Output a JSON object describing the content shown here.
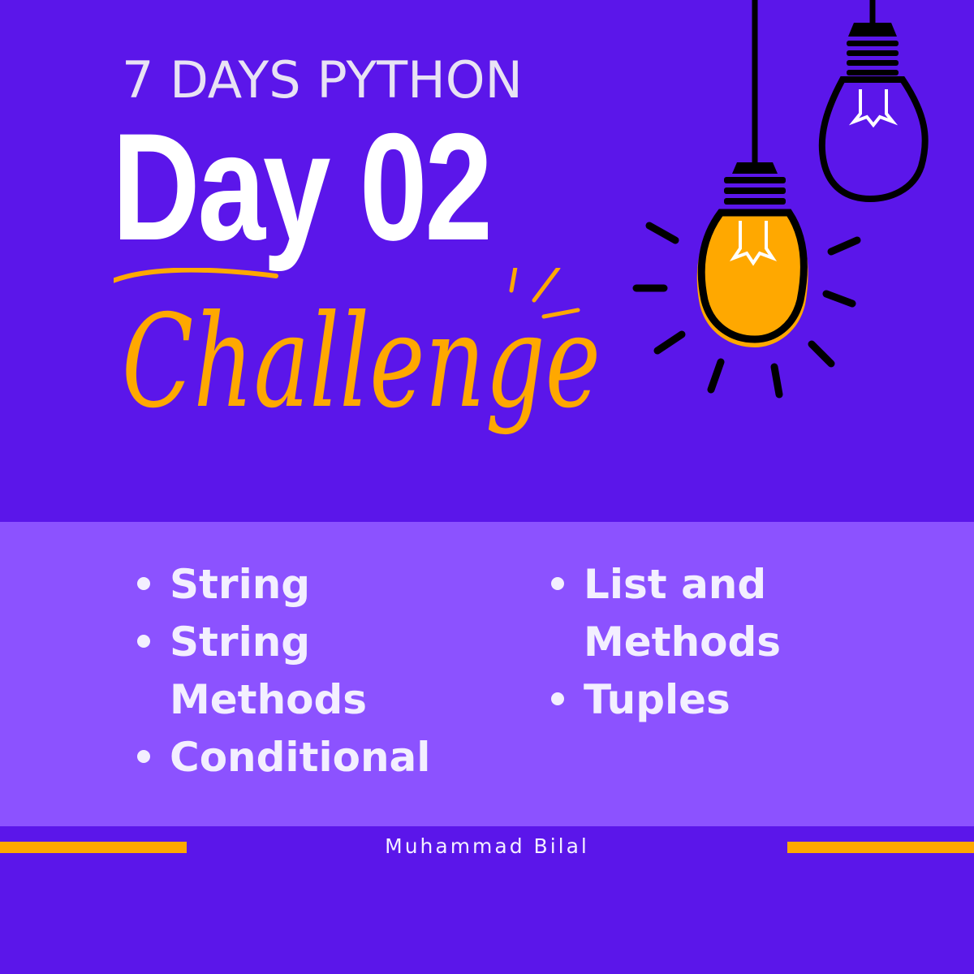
{
  "poster": {
    "subtitle": "7 DAYS PYTHON",
    "title": "Day 02",
    "script_word": "Challenge",
    "topics_left": [
      "String",
      "String Methods",
      "Conditional"
    ],
    "topics_right": [
      "List and Methods",
      "Tuples"
    ],
    "author": "Muhammad Bilal"
  },
  "colors": {
    "background": "#5b16ea",
    "panel": "#8c52ff",
    "accent": "#ffa800",
    "text": "#ffffff",
    "bulb_outline": "#000000"
  },
  "icons": [
    "light-bulb-icon",
    "light-bulb-lit-icon"
  ]
}
